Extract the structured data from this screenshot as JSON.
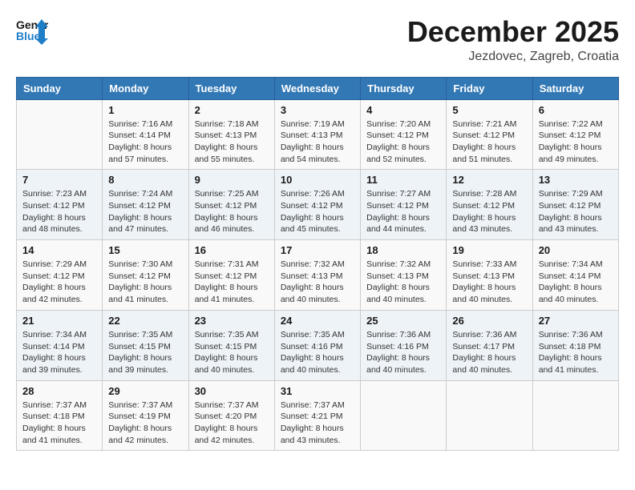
{
  "header": {
    "logo_line1": "General",
    "logo_line2": "Blue",
    "month": "December 2025",
    "location": "Jezdovec, Zagreb, Croatia"
  },
  "weekdays": [
    "Sunday",
    "Monday",
    "Tuesday",
    "Wednesday",
    "Thursday",
    "Friday",
    "Saturday"
  ],
  "weeks": [
    [
      {
        "day": "",
        "info": ""
      },
      {
        "day": "1",
        "info": "Sunrise: 7:16 AM\nSunset: 4:14 PM\nDaylight: 8 hours\nand 57 minutes."
      },
      {
        "day": "2",
        "info": "Sunrise: 7:18 AM\nSunset: 4:13 PM\nDaylight: 8 hours\nand 55 minutes."
      },
      {
        "day": "3",
        "info": "Sunrise: 7:19 AM\nSunset: 4:13 PM\nDaylight: 8 hours\nand 54 minutes."
      },
      {
        "day": "4",
        "info": "Sunrise: 7:20 AM\nSunset: 4:12 PM\nDaylight: 8 hours\nand 52 minutes."
      },
      {
        "day": "5",
        "info": "Sunrise: 7:21 AM\nSunset: 4:12 PM\nDaylight: 8 hours\nand 51 minutes."
      },
      {
        "day": "6",
        "info": "Sunrise: 7:22 AM\nSunset: 4:12 PM\nDaylight: 8 hours\nand 49 minutes."
      }
    ],
    [
      {
        "day": "7",
        "info": "Sunrise: 7:23 AM\nSunset: 4:12 PM\nDaylight: 8 hours\nand 48 minutes."
      },
      {
        "day": "8",
        "info": "Sunrise: 7:24 AM\nSunset: 4:12 PM\nDaylight: 8 hours\nand 47 minutes."
      },
      {
        "day": "9",
        "info": "Sunrise: 7:25 AM\nSunset: 4:12 PM\nDaylight: 8 hours\nand 46 minutes."
      },
      {
        "day": "10",
        "info": "Sunrise: 7:26 AM\nSunset: 4:12 PM\nDaylight: 8 hours\nand 45 minutes."
      },
      {
        "day": "11",
        "info": "Sunrise: 7:27 AM\nSunset: 4:12 PM\nDaylight: 8 hours\nand 44 minutes."
      },
      {
        "day": "12",
        "info": "Sunrise: 7:28 AM\nSunset: 4:12 PM\nDaylight: 8 hours\nand 43 minutes."
      },
      {
        "day": "13",
        "info": "Sunrise: 7:29 AM\nSunset: 4:12 PM\nDaylight: 8 hours\nand 43 minutes."
      }
    ],
    [
      {
        "day": "14",
        "info": "Sunrise: 7:29 AM\nSunset: 4:12 PM\nDaylight: 8 hours\nand 42 minutes."
      },
      {
        "day": "15",
        "info": "Sunrise: 7:30 AM\nSunset: 4:12 PM\nDaylight: 8 hours\nand 41 minutes."
      },
      {
        "day": "16",
        "info": "Sunrise: 7:31 AM\nSunset: 4:12 PM\nDaylight: 8 hours\nand 41 minutes."
      },
      {
        "day": "17",
        "info": "Sunrise: 7:32 AM\nSunset: 4:13 PM\nDaylight: 8 hours\nand 40 minutes."
      },
      {
        "day": "18",
        "info": "Sunrise: 7:32 AM\nSunset: 4:13 PM\nDaylight: 8 hours\nand 40 minutes."
      },
      {
        "day": "19",
        "info": "Sunrise: 7:33 AM\nSunset: 4:13 PM\nDaylight: 8 hours\nand 40 minutes."
      },
      {
        "day": "20",
        "info": "Sunrise: 7:34 AM\nSunset: 4:14 PM\nDaylight: 8 hours\nand 40 minutes."
      }
    ],
    [
      {
        "day": "21",
        "info": "Sunrise: 7:34 AM\nSunset: 4:14 PM\nDaylight: 8 hours\nand 39 minutes."
      },
      {
        "day": "22",
        "info": "Sunrise: 7:35 AM\nSunset: 4:15 PM\nDaylight: 8 hours\nand 39 minutes."
      },
      {
        "day": "23",
        "info": "Sunrise: 7:35 AM\nSunset: 4:15 PM\nDaylight: 8 hours\nand 40 minutes."
      },
      {
        "day": "24",
        "info": "Sunrise: 7:35 AM\nSunset: 4:16 PM\nDaylight: 8 hours\nand 40 minutes."
      },
      {
        "day": "25",
        "info": "Sunrise: 7:36 AM\nSunset: 4:16 PM\nDaylight: 8 hours\nand 40 minutes."
      },
      {
        "day": "26",
        "info": "Sunrise: 7:36 AM\nSunset: 4:17 PM\nDaylight: 8 hours\nand 40 minutes."
      },
      {
        "day": "27",
        "info": "Sunrise: 7:36 AM\nSunset: 4:18 PM\nDaylight: 8 hours\nand 41 minutes."
      }
    ],
    [
      {
        "day": "28",
        "info": "Sunrise: 7:37 AM\nSunset: 4:18 PM\nDaylight: 8 hours\nand 41 minutes."
      },
      {
        "day": "29",
        "info": "Sunrise: 7:37 AM\nSunset: 4:19 PM\nDaylight: 8 hours\nand 42 minutes."
      },
      {
        "day": "30",
        "info": "Sunrise: 7:37 AM\nSunset: 4:20 PM\nDaylight: 8 hours\nand 42 minutes."
      },
      {
        "day": "31",
        "info": "Sunrise: 7:37 AM\nSunset: 4:21 PM\nDaylight: 8 hours\nand 43 minutes."
      },
      {
        "day": "",
        "info": ""
      },
      {
        "day": "",
        "info": ""
      },
      {
        "day": "",
        "info": ""
      }
    ]
  ]
}
